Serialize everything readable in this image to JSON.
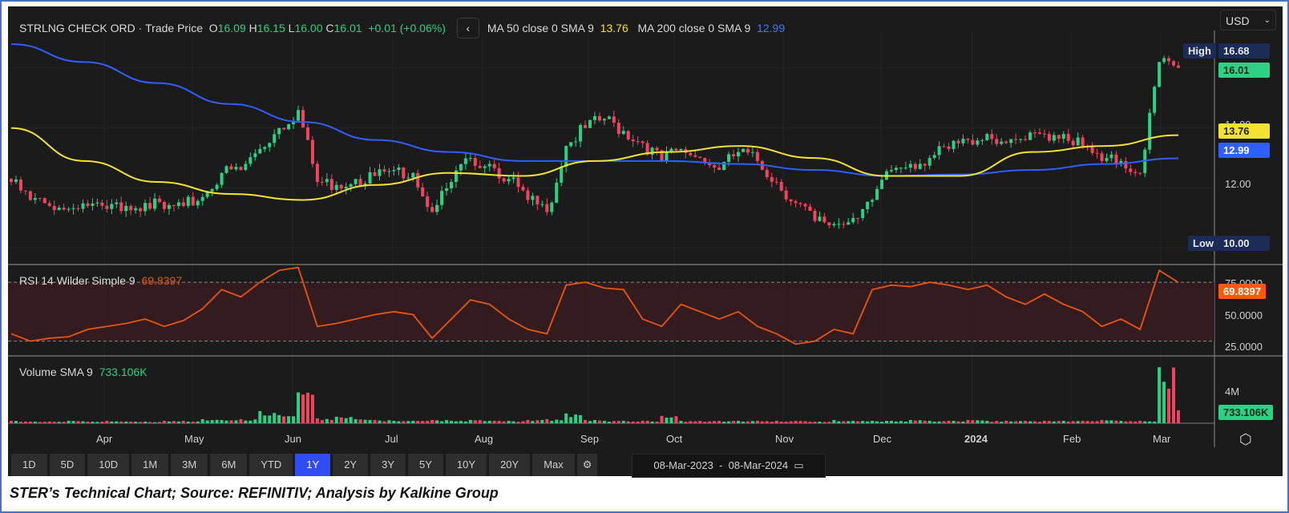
{
  "header": {
    "instrument": "STRLNG CHECK ORD",
    "source": "Trade Price",
    "o_label": "O",
    "o": "16.09",
    "h_label": "H",
    "h": "16.15",
    "l_label": "L",
    "l": "16.00",
    "c_label": "C",
    "c": "16.01",
    "change": "+0.01 (+0.06%)",
    "ma50_label": "MA 50 close 0 SMA 9",
    "ma50": "13.76",
    "ma200_label": "MA 200 close 0 SMA 9",
    "ma200": "12.99",
    "back_icon": "chevron-left-icon"
  },
  "currency": "USD",
  "price_axis": {
    "ticks": [
      "14.00",
      "12.00"
    ],
    "high_label": "High",
    "high": "16.68",
    "low_label": "Low",
    "low": "10.00",
    "last": "16.01",
    "ma50_tag": "13.76",
    "ma200_tag": "12.99"
  },
  "rsi": {
    "title": "RSI 14 Wilder Simple 9",
    "value": "69.8397",
    "ticks": [
      "75.0000",
      "50.0000",
      "25.0000"
    ]
  },
  "volume": {
    "title": "Volume SMA 9",
    "value": "733.106K",
    "tick": "4M"
  },
  "x_axis": {
    "labels": [
      "Apr",
      "May",
      "Jun",
      "Jul",
      "Aug",
      "Sep",
      "Oct",
      "Nov",
      "Dec",
      "2024",
      "Feb",
      "Mar"
    ]
  },
  "ranges": [
    "1D",
    "5D",
    "10D",
    "1M",
    "3M",
    "6M",
    "YTD",
    "1Y",
    "2Y",
    "3Y",
    "5Y",
    "10Y",
    "20Y",
    "Max"
  ],
  "active_range": "1Y",
  "date_from": "08-Mar-2023",
  "date_sep": "-",
  "date_to": "08-Mar-2024",
  "caption": "STER’s Technical Chart; Source: REFINITIV; Analysis by Kalkine Group",
  "colors": {
    "up": "#2fcf84",
    "down": "#f0455f",
    "ma50": "#f4e233",
    "ma200": "#2f5fff",
    "rsi": "#e8560c",
    "bg": "#1b1b1b"
  },
  "chart_data": {
    "type": "candlestick",
    "period": [
      "08-Mar-2023",
      "08-Mar-2024"
    ],
    "close_weekly": [
      12.2,
      11.6,
      11.4,
      11.3,
      11.4,
      11.3,
      11.4,
      11.5,
      11.3,
      11.4,
      11.7,
      12.5,
      12.6,
      13.3,
      14.0,
      14.6,
      12.2,
      12.1,
      12.3,
      12.4,
      12.6,
      12.5,
      11.2,
      12.2,
      13.0,
      12.8,
      12.3,
      11.6,
      11.2,
      13.4,
      14.0,
      14.3,
      13.9,
      13.5,
      12.9,
      13.3,
      13.0,
      12.6,
      13.2,
      12.9,
      12.2,
      11.5,
      10.9,
      10.8,
      11.0,
      11.6,
      12.6,
      12.8,
      13.0,
      13.3,
      13.6,
      13.8,
      13.5,
      13.6,
      13.8,
      13.8,
      13.4,
      12.9,
      12.9,
      12.5,
      16.2,
      16.01
    ],
    "ma50_monthly": [
      14.0,
      12.9,
      12.2,
      11.8,
      11.6,
      12.1,
      12.5,
      12.4,
      12.9,
      13.2,
      13.4,
      13.0,
      12.4,
      12.4,
      13.2,
      13.4,
      13.76
    ],
    "ma200_monthly": [
      16.8,
      16.2,
      15.5,
      14.8,
      14.2,
      13.6,
      13.2,
      12.9,
      12.9,
      12.9,
      12.8,
      12.6,
      12.4,
      12.45,
      12.6,
      12.8,
      12.99
    ],
    "rsi_weekly": [
      35,
      30,
      32,
      33,
      38,
      40,
      42,
      45,
      40,
      44,
      52,
      65,
      60,
      70,
      78,
      80,
      40,
      42,
      45,
      48,
      50,
      48,
      32,
      45,
      58,
      55,
      45,
      38,
      35,
      68,
      70,
      66,
      65,
      45,
      40,
      55,
      50,
      45,
      50,
      40,
      35,
      28,
      30,
      38,
      35,
      65,
      68,
      67,
      70,
      68,
      65,
      68,
      60,
      55,
      62,
      55,
      50,
      40,
      45,
      38,
      78,
      69.84
    ],
    "volume_weekly_m": [
      0.3,
      0.2,
      0.2,
      0.3,
      0.2,
      0.3,
      0.2,
      0.2,
      0.3,
      0.3,
      0.5,
      0.4,
      0.5,
      1.5,
      1.0,
      3.8,
      0.6,
      0.8,
      0.5,
      0.4,
      0.3,
      0.3,
      0.4,
      0.3,
      0.4,
      0.3,
      0.3,
      0.4,
      0.5,
      1.2,
      0.4,
      0.3,
      0.3,
      0.3,
      0.9,
      0.3,
      0.3,
      0.3,
      0.3,
      0.3,
      0.3,
      0.3,
      0.2,
      0.4,
      0.3,
      0.3,
      0.3,
      0.4,
      0.3,
      0.3,
      0.4,
      0.3,
      0.3,
      0.3,
      0.3,
      0.3,
      0.3,
      0.4,
      0.3,
      0.3,
      6.9,
      1.6
    ],
    "price_ylim": [
      9.5,
      17.2
    ],
    "rsi_ylim": [
      20,
      82
    ],
    "rsi_bands": [
      30,
      70
    ],
    "volume_ylim": [
      0,
      7.5
    ]
  }
}
